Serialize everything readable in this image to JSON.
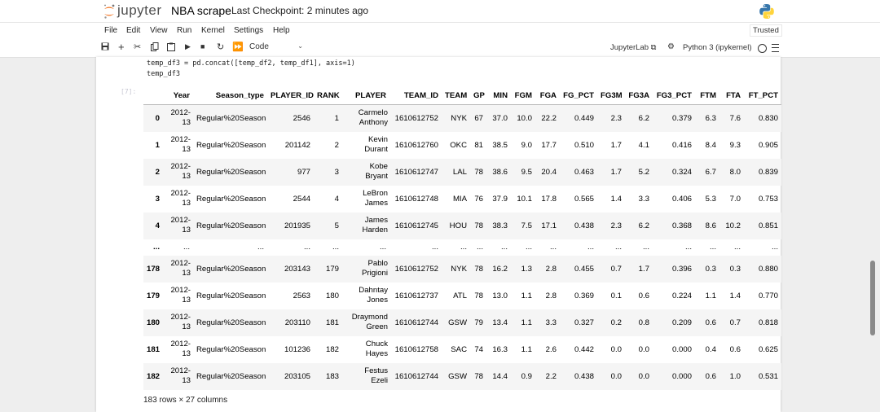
{
  "header": {
    "logo_text": "jupyter",
    "notebook_title": "NBA scrape",
    "checkpoint": "Last Checkpoint: 2 minutes ago"
  },
  "menu": [
    "File",
    "Edit",
    "View",
    "Run",
    "Kernel",
    "Settings",
    "Help"
  ],
  "trusted": "Trusted",
  "toolbar": {
    "cell_type": "Code",
    "jupyterlab_label": "JupyterLab",
    "kernel_label": "Python 3 (ipykernel)"
  },
  "cell": {
    "code_line1": "temp_df3 = pd.concat([temp_df2, temp_df1], axis=1)",
    "code_line2": "temp_df3",
    "prompt": "[7]:"
  },
  "df": {
    "columns": [
      "",
      "Year",
      "Season_type",
      "PLAYER_ID",
      "RANK",
      "PLAYER",
      "TEAM_ID",
      "TEAM",
      "GP",
      "MIN",
      "FGM",
      "FGA",
      "FG_PCT",
      "FG3M",
      "FG3A",
      "FG3_PCT",
      "FTM",
      "FTA",
      "FT_PCT"
    ],
    "rows": [
      [
        "0",
        "2012-13",
        "Regular%20Season",
        "2546",
        "1",
        "Carmelo Anthony",
        "1610612752",
        "NYK",
        "67",
        "37.0",
        "10.0",
        "22.2",
        "0.449",
        "2.3",
        "6.2",
        "0.379",
        "6.3",
        "7.6",
        "0.830"
      ],
      [
        "1",
        "2012-13",
        "Regular%20Season",
        "201142",
        "2",
        "Kevin Durant",
        "1610612760",
        "OKC",
        "81",
        "38.5",
        "9.0",
        "17.7",
        "0.510",
        "1.7",
        "4.1",
        "0.416",
        "8.4",
        "9.3",
        "0.905"
      ],
      [
        "2",
        "2012-13",
        "Regular%20Season",
        "977",
        "3",
        "Kobe Bryant",
        "1610612747",
        "LAL",
        "78",
        "38.6",
        "9.5",
        "20.4",
        "0.463",
        "1.7",
        "5.2",
        "0.324",
        "6.7",
        "8.0",
        "0.839"
      ],
      [
        "3",
        "2012-13",
        "Regular%20Season",
        "2544",
        "4",
        "LeBron James",
        "1610612748",
        "MIA",
        "76",
        "37.9",
        "10.1",
        "17.8",
        "0.565",
        "1.4",
        "3.3",
        "0.406",
        "5.3",
        "7.0",
        "0.753"
      ],
      [
        "4",
        "2012-13",
        "Regular%20Season",
        "201935",
        "5",
        "James Harden",
        "1610612745",
        "HOU",
        "78",
        "38.3",
        "7.5",
        "17.1",
        "0.438",
        "2.3",
        "6.2",
        "0.368",
        "8.6",
        "10.2",
        "0.851"
      ],
      [
        "...",
        "...",
        "...",
        "...",
        "...",
        "...",
        "...",
        "...",
        "...",
        "...",
        "...",
        "...",
        "...",
        "...",
        "...",
        "...",
        "...",
        "...",
        "..."
      ],
      [
        "178",
        "2012-13",
        "Regular%20Season",
        "203143",
        "179",
        "Pablo Prigioni",
        "1610612752",
        "NYK",
        "78",
        "16.2",
        "1.3",
        "2.8",
        "0.455",
        "0.7",
        "1.7",
        "0.396",
        "0.3",
        "0.3",
        "0.880"
      ],
      [
        "179",
        "2012-13",
        "Regular%20Season",
        "2563",
        "180",
        "Dahntay Jones",
        "1610612737",
        "ATL",
        "78",
        "13.0",
        "1.1",
        "2.8",
        "0.369",
        "0.1",
        "0.6",
        "0.224",
        "1.1",
        "1.4",
        "0.770"
      ],
      [
        "180",
        "2012-13",
        "Regular%20Season",
        "203110",
        "181",
        "Draymond Green",
        "1610612744",
        "GSW",
        "79",
        "13.4",
        "1.1",
        "3.3",
        "0.327",
        "0.2",
        "0.8",
        "0.209",
        "0.6",
        "0.7",
        "0.818"
      ],
      [
        "181",
        "2012-13",
        "Regular%20Season",
        "101236",
        "182",
        "Chuck Hayes",
        "1610612758",
        "SAC",
        "74",
        "16.3",
        "1.1",
        "2.6",
        "0.442",
        "0.0",
        "0.0",
        "0.000",
        "0.4",
        "0.6",
        "0.625"
      ],
      [
        "182",
        "2012-13",
        "Regular%20Season",
        "203105",
        "183",
        "Festus Ezeli",
        "1610612744",
        "GSW",
        "78",
        "14.4",
        "0.9",
        "2.2",
        "0.438",
        "0.0",
        "0.0",
        "0.000",
        "0.6",
        "1.0",
        "0.531"
      ]
    ],
    "shape": "183 rows × 27 columns"
  },
  "colors": {
    "jupyter_orange": "#f37726",
    "python_blue": "#3776ab",
    "python_yellow": "#ffd43b"
  }
}
